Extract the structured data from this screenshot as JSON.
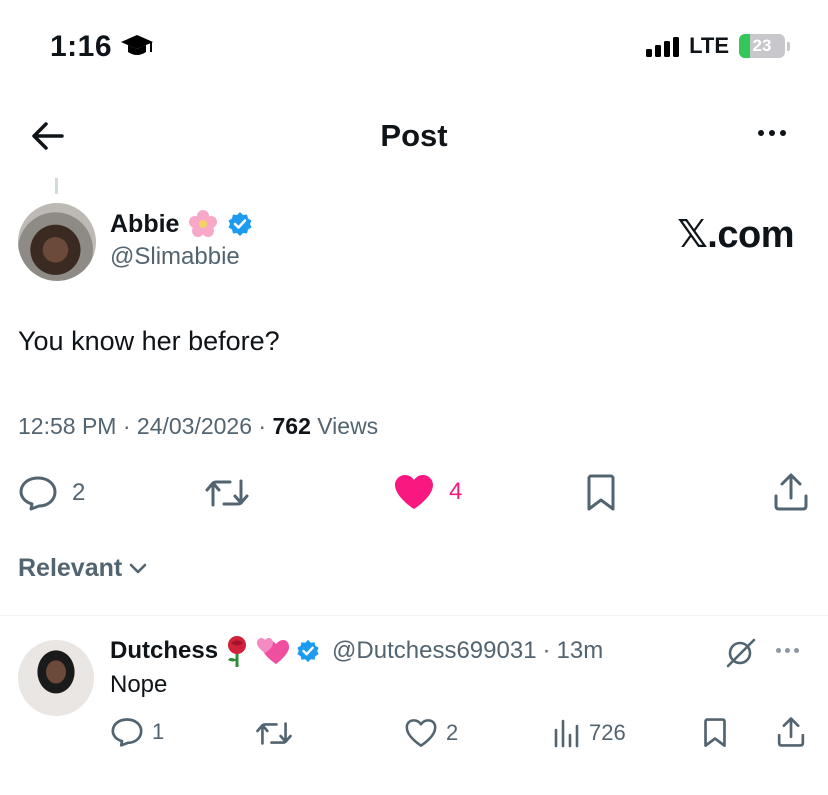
{
  "status_bar": {
    "time": "1:16",
    "network": "LTE",
    "battery": "23",
    "battery_level": 0.23
  },
  "header": {
    "title": "Post"
  },
  "post": {
    "author_name": "Abbie",
    "author_handle": "@Slimabbie",
    "watermark": "𝕏.com",
    "text": "You know her before?",
    "time": "12:58 PM",
    "date": "24/03/2026",
    "views_count": "762",
    "views_label": "Views",
    "replies": "2",
    "likes": "4",
    "liked": true
  },
  "sort": {
    "label": "Relevant"
  },
  "reply": {
    "author_name": "Dutchess",
    "author_handle": "@Dutchess699031",
    "time": "13m",
    "text": "Nope",
    "replies": "1",
    "likes": "2",
    "views": "726"
  },
  "colors": {
    "accent_blue": "#1d9bf0",
    "like_pink": "#f91880",
    "muted": "#536471"
  }
}
